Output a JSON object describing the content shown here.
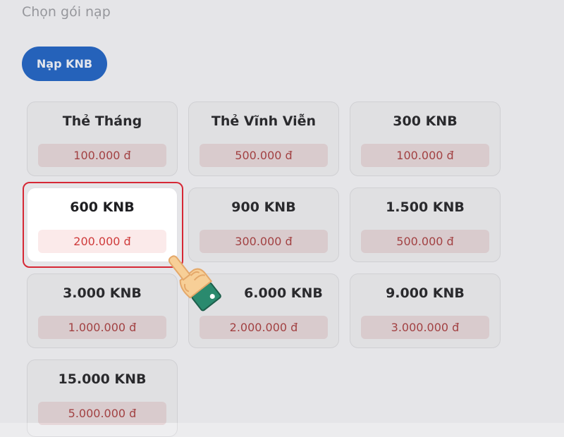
{
  "header": {
    "title": "Chọn gói nạp"
  },
  "action": {
    "button_label": "Nạp KNB"
  },
  "packages": [
    {
      "name": "Thẻ Tháng",
      "price": "100.000 đ"
    },
    {
      "name": "Thẻ Vĩnh Viễn",
      "price": "500.000 đ"
    },
    {
      "name": "300 KNB",
      "price": "100.000 đ"
    },
    {
      "name": "600 KNB",
      "price": "200.000 đ",
      "selected": true
    },
    {
      "name": "900 KNB",
      "price": "300.000 đ"
    },
    {
      "name": "1.500 KNB",
      "price": "500.000 đ"
    },
    {
      "name": "3.000 KNB",
      "price": "1.000.000 đ"
    },
    {
      "name": "6.000 KNB",
      "price": "2.000.000 đ"
    },
    {
      "name": "9.000 KNB",
      "price": "3.000.000 đ"
    },
    {
      "name": "15.000 KNB",
      "price": "5.000.000 đ"
    }
  ],
  "colors": {
    "primary": "#1a5fc2",
    "price_text": "#cf3b3b",
    "selection_border": "#d62835",
    "hand_skin": "#f7cf97",
    "cuff": "#2a8a6e"
  },
  "pointer": {
    "icon": "pointing-hand-icon"
  }
}
